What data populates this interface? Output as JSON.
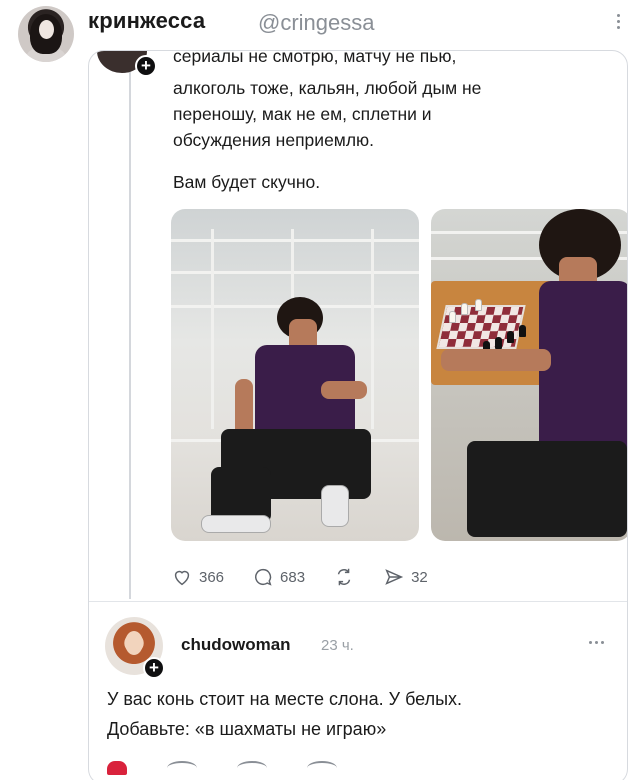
{
  "outer": {
    "name": "кринжесса",
    "handle": "@cringessa"
  },
  "quoted": {
    "lines": [
      "сериалы не смотрю, матчу не пью,",
      "алкоголь тоже, кальян, любой дым не",
      "переношу, мак не ем, сплетни и",
      "обсуждения неприемлю.",
      "Вам будет скучно."
    ],
    "actions": {
      "likes": "366",
      "replies": "683",
      "shares": "32"
    }
  },
  "reply": {
    "name": "chudowoman",
    "time": "23 ч.",
    "lines": [
      "У вас конь стоит на месте слона. У белых.",
      "Добавьте: «в шахматы не играю»"
    ]
  },
  "icons": {
    "like": "heart-icon",
    "reply": "comment-icon",
    "repost": "repost-icon",
    "share": "send-icon",
    "more": "more-icon",
    "follow": "plus-icon"
  },
  "colors": {
    "text": "#1b1b1b",
    "muted": "#8a8f96",
    "border": "#d7dadf",
    "like_red": "#d9223c"
  }
}
